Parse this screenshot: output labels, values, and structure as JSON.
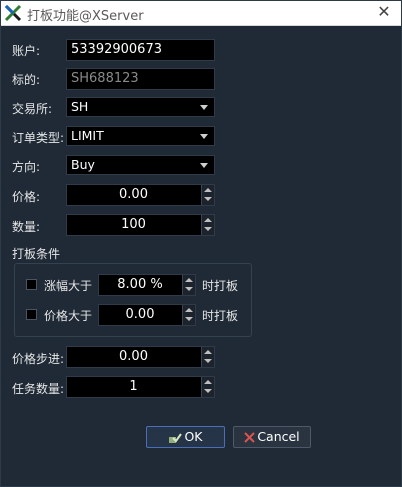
{
  "window": {
    "title": "打板功能@XServer",
    "close_glyph": "✕"
  },
  "form": {
    "account": {
      "label": "账户:",
      "value": "53392900673"
    },
    "symbol": {
      "label": "标的:",
      "value": "SH688123"
    },
    "exchange": {
      "label": "交易所:",
      "value": "SH"
    },
    "order_type": {
      "label": "订单类型:",
      "value": "LIMIT"
    },
    "direction": {
      "label": "方向:",
      "value": "Buy"
    },
    "price": {
      "label": "价格:",
      "value": "0.00"
    },
    "quantity": {
      "label": "数量:",
      "value": "100"
    }
  },
  "conditions": {
    "title": "打板条件",
    "rise": {
      "label": "涨幅大于",
      "value": "8.00  %",
      "suffix": "时打板",
      "checked": false
    },
    "price_above": {
      "label": "价格大于",
      "value": "0.00",
      "suffix": "时打板",
      "checked": false
    }
  },
  "extra": {
    "price_step": {
      "label": "价格步进:",
      "value": "0.00"
    },
    "task_count": {
      "label": "任务数量:",
      "value": "1"
    }
  },
  "buttons": {
    "ok": "OK",
    "cancel": "Cancel"
  },
  "icons": {
    "app": "xserver-x-icon",
    "ok": "check-icon",
    "cancel": "x-cancel-icon"
  },
  "colors": {
    "background": "#1f2a36",
    "field": "#000000",
    "titlebar": "#ffffff",
    "ok_border": "#4a6fb8",
    "cancel_icon": "#d9534f"
  }
}
